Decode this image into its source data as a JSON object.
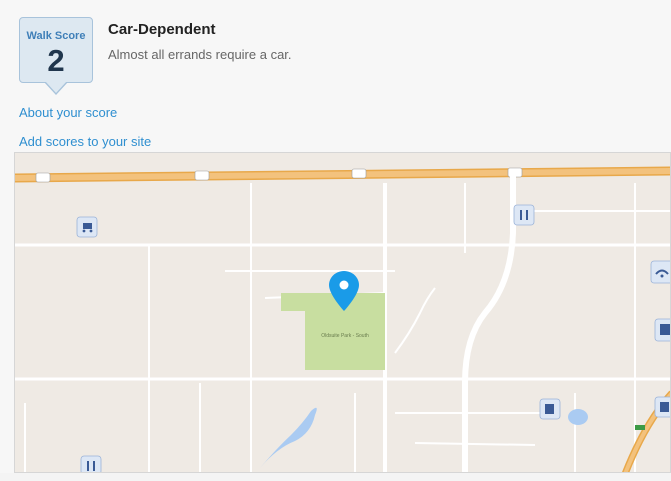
{
  "score": {
    "badge_label": "Walk Score",
    "value": "2",
    "title": "Car-Dependent",
    "description": "Almost all errands require a car."
  },
  "links": {
    "about": "About your score",
    "add": "Add scores to your site"
  },
  "map": {
    "park_label": "Oldsuite Park - South",
    "location_pin_color": "#1a9be8",
    "highway_color": "#f0b966",
    "park_color": "#c8dea0",
    "water_color": "#aacbf2"
  }
}
